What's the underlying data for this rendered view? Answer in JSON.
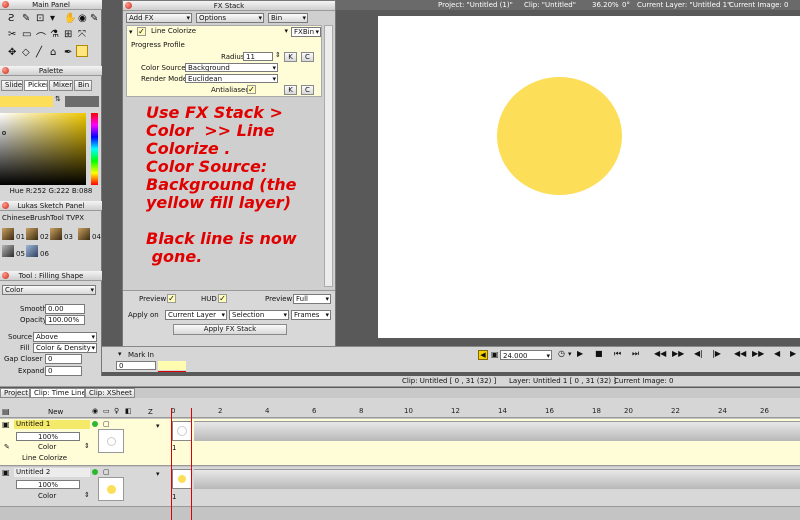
{
  "status": {
    "project": "Project: \"Untitled (1)\"",
    "clip": "Clip: \"Untitled\"",
    "zoom": "36.20%",
    "angle": "0°",
    "layer": "Current Layer: \"Untitled 1\"",
    "image": "Current Image: 0"
  },
  "main_panel": {
    "title": "Main Panel"
  },
  "palette": {
    "title": "Palette",
    "tabs": [
      "Slider",
      "Picker",
      "Mixer",
      "Bin"
    ],
    "hue_readout": "Hue R:252 G:222 B:088",
    "current_color": "#fcde58"
  },
  "sketch_panel": {
    "title": "Lukas Sketch Panel",
    "preset": "ChineseBrushTool TVPX",
    "brushes": [
      "01",
      "02",
      "03",
      "04",
      "05",
      "06"
    ]
  },
  "tool_panel": {
    "title": "Tool : Filling Shape",
    "mode": "Color",
    "smooth_label": "Smooth",
    "smooth_value": "0.00",
    "opacity_label": "Opacity",
    "opacity_value": "100.00%",
    "source_label": "Source",
    "source_value": "Above",
    "fill_label": "Fill",
    "fill_value": "Color & Density",
    "gap_label": "Gap Closer",
    "gap_value": "0",
    "expand_label": "Expand",
    "expand_value": "0"
  },
  "fx_stack": {
    "title": "FX Stack",
    "add_fx": "Add FX",
    "options": "Options",
    "bin": "Bin",
    "effect_name": "Line Colorize",
    "fxbin": "FXBin",
    "progress_profile": "Progress Profile",
    "radius_label": "Radius",
    "radius_value": "11",
    "color_source_label": "Color Source",
    "color_source_value": "Background",
    "render_mode_label": "Render Mode",
    "render_mode_value": "Euclidean",
    "antialiased_label": "Antialiased",
    "k_label": "K",
    "c_label": "C",
    "note_text": "Use FX Stack >\nColor  >> Line\nColorize .\nColor Source:\nBackground (the\nyellow fill layer)\n\nBlack line is now\n gone.",
    "preview_label": "Preview",
    "hud_label": "HUD",
    "preview2_label": "Preview",
    "preview2_value": "Full",
    "apply_on_label": "Apply on",
    "apply_on_value": "Current Layer",
    "selection_value": "Selection",
    "frames_value": "Frames",
    "apply_button": "Apply FX Stack"
  },
  "canvas": {
    "circle_color": "#fcde58"
  },
  "playback": {
    "fps": "24.000",
    "mark_in": "Mark In",
    "frame_value": "0"
  },
  "timeline_info": {
    "clip": "Clip: Untitled [ 0 , 31  (32) ]",
    "layer": "Layer: Untitled 1 [ 0 , 31  (32) ]",
    "image": "Current Image: 0"
  },
  "tabs": [
    "Project",
    "Clip: Time Line",
    "Clip: XSheet"
  ],
  "timeline": {
    "new_label": "New",
    "z_label": "Z",
    "ruler": [
      "0",
      "2",
      "4",
      "6",
      "8",
      "10",
      "12",
      "14",
      "16",
      "18",
      "20",
      "22",
      "24",
      "26"
    ],
    "layers": [
      {
        "name": "Untitled 1",
        "opacity": "100%",
        "mode": "Color",
        "fx": "Line Colorize",
        "frame": "1"
      },
      {
        "name": "Untitled 2",
        "opacity": "100%",
        "mode": "Color",
        "frame": "1"
      }
    ]
  }
}
